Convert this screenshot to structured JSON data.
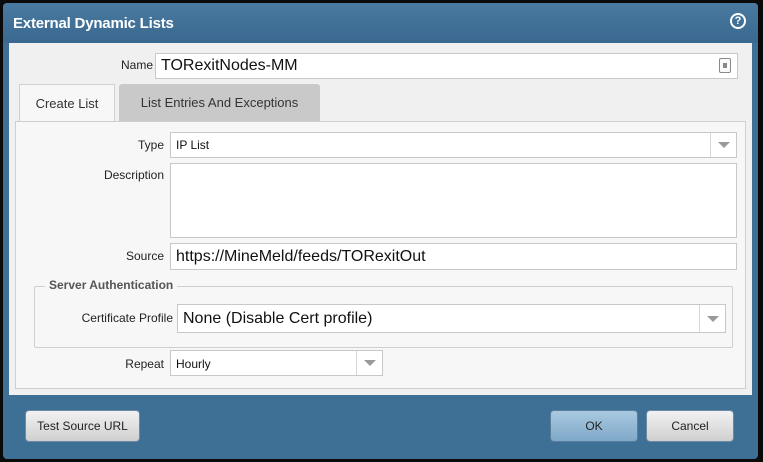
{
  "dialog": {
    "title": "External Dynamic Lists",
    "help_icon": "question-circle-icon"
  },
  "name_field": {
    "label": "Name",
    "value": "TORexitNodes-MM",
    "icon": "lock-icon"
  },
  "tabs": [
    {
      "label": "Create List",
      "active": true
    },
    {
      "label": "List Entries And Exceptions",
      "active": false
    }
  ],
  "create_list": {
    "type_label": "Type",
    "type_value": "IP List",
    "description_label": "Description",
    "description_value": "",
    "source_label": "Source",
    "source_value": "https://MineMeld/feeds/TORexitOut",
    "server_auth": {
      "legend": "Server Authentication",
      "cert_profile_label": "Certificate Profile",
      "cert_profile_value": "None (Disable Cert profile)"
    },
    "repeat_label": "Repeat",
    "repeat_value": "Hourly"
  },
  "footer": {
    "test_source_label": "Test Source URL",
    "ok_label": "OK",
    "cancel_label": "Cancel"
  },
  "colors": {
    "titlebar": "#3e6f95",
    "body_bg": "#f0f0f0",
    "ok_button": "#8fb4d2"
  }
}
